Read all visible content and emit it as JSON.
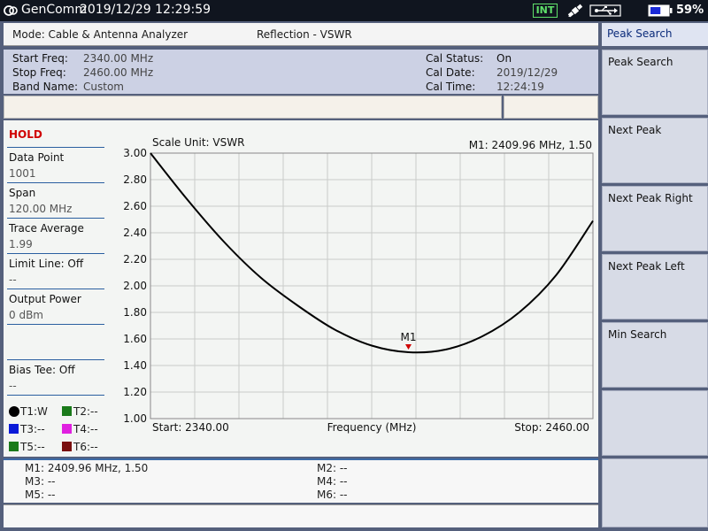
{
  "status_bar": {
    "brand": "GenComm",
    "datetime": "2019/12/29 12:29:59",
    "int_badge": "INT",
    "battery_percent": "59%",
    "battery_level": 0.59,
    "icons": [
      "gencomm-logo-icon",
      "gps-satellite-icon",
      "usb-icon",
      "battery-icon"
    ]
  },
  "mode_bar": {
    "mode": "Mode: Cable & Antenna Analyzer",
    "measurement": "Reflection - VSWR"
  },
  "info": {
    "start_freq_label": "Start Freq:",
    "start_freq_value": "2340.00 MHz",
    "stop_freq_label": "Stop Freq:",
    "stop_freq_value": "2460.00 MHz",
    "band_name_label": "Band Name:",
    "band_name_value": "Custom",
    "cal_status_label": "Cal Status:",
    "cal_status_value": "On",
    "cal_date_label": "Cal Date:",
    "cal_date_value": "2019/12/29",
    "cal_time_label": "Cal Time:",
    "cal_time_value": "12:24:19"
  },
  "params": {
    "hold": "HOLD",
    "data_point_label": "Data Point",
    "data_point_value": "1001",
    "span_label": "Span",
    "span_value": "120.00 MHz",
    "trace_average_label": "Trace Average",
    "trace_average_value": "1.99",
    "limit_line_label": "Limit Line: Off",
    "limit_line_value": "--",
    "output_power_label": "Output Power",
    "output_power_value": "0 dBm",
    "bias_tee_label": "Bias Tee: Off",
    "bias_tee_value": "--"
  },
  "traces": [
    {
      "label": "T1:W",
      "color": "#000000"
    },
    {
      "label": "T2:--",
      "color": "#1a7a1a"
    },
    {
      "label": "T3:--",
      "color": "#0a1ad8"
    },
    {
      "label": "T4:--",
      "color": "#e020e0"
    },
    {
      "label": "T5:--",
      "color": "#1a7a1a"
    },
    {
      "label": "T6:--",
      "color": "#7a1010"
    }
  ],
  "chart_data": {
    "type": "line",
    "scale_unit": "Scale Unit: VSWR",
    "marker_readout": "M1: 2409.96 MHz, 1.50",
    "xlabel": "Frequency (MHz)",
    "start_label": "Start: 2340.00",
    "stop_label": "Stop: 2460.00",
    "xlim": [
      2340,
      2460
    ],
    "ylim": [
      1.0,
      3.0
    ],
    "yticks": [
      "3.00",
      "2.80",
      "2.60",
      "2.40",
      "2.20",
      "2.00",
      "1.80",
      "1.60",
      "1.40",
      "1.20",
      "1.00"
    ],
    "grid": true,
    "series": [
      {
        "name": "T1",
        "color": "#000000",
        "x": [
          2340,
          2350,
          2360,
          2370,
          2380,
          2390,
          2400,
          2410,
          2420,
          2430,
          2440,
          2450,
          2460
        ],
        "y": [
          3.0,
          2.65,
          2.33,
          2.06,
          1.85,
          1.67,
          1.55,
          1.5,
          1.52,
          1.62,
          1.8,
          2.08,
          2.49
        ]
      }
    ],
    "markers": [
      {
        "label": "M1",
        "x": 2409.96,
        "y": 1.5,
        "color": "#d00000"
      }
    ]
  },
  "marker_table": {
    "m1": "M1: 2409.96 MHz, 1.50",
    "m2": "M2: --",
    "m3": "M3: --",
    "m4": "M4: --",
    "m5": "M5: --",
    "m6": "M6: --"
  },
  "softkeys": {
    "title": "Peak Search",
    "items": [
      "Peak Search",
      "Next Peak",
      "Next Peak Right",
      "Next Peak Left",
      "Min Search",
      "",
      ""
    ]
  }
}
